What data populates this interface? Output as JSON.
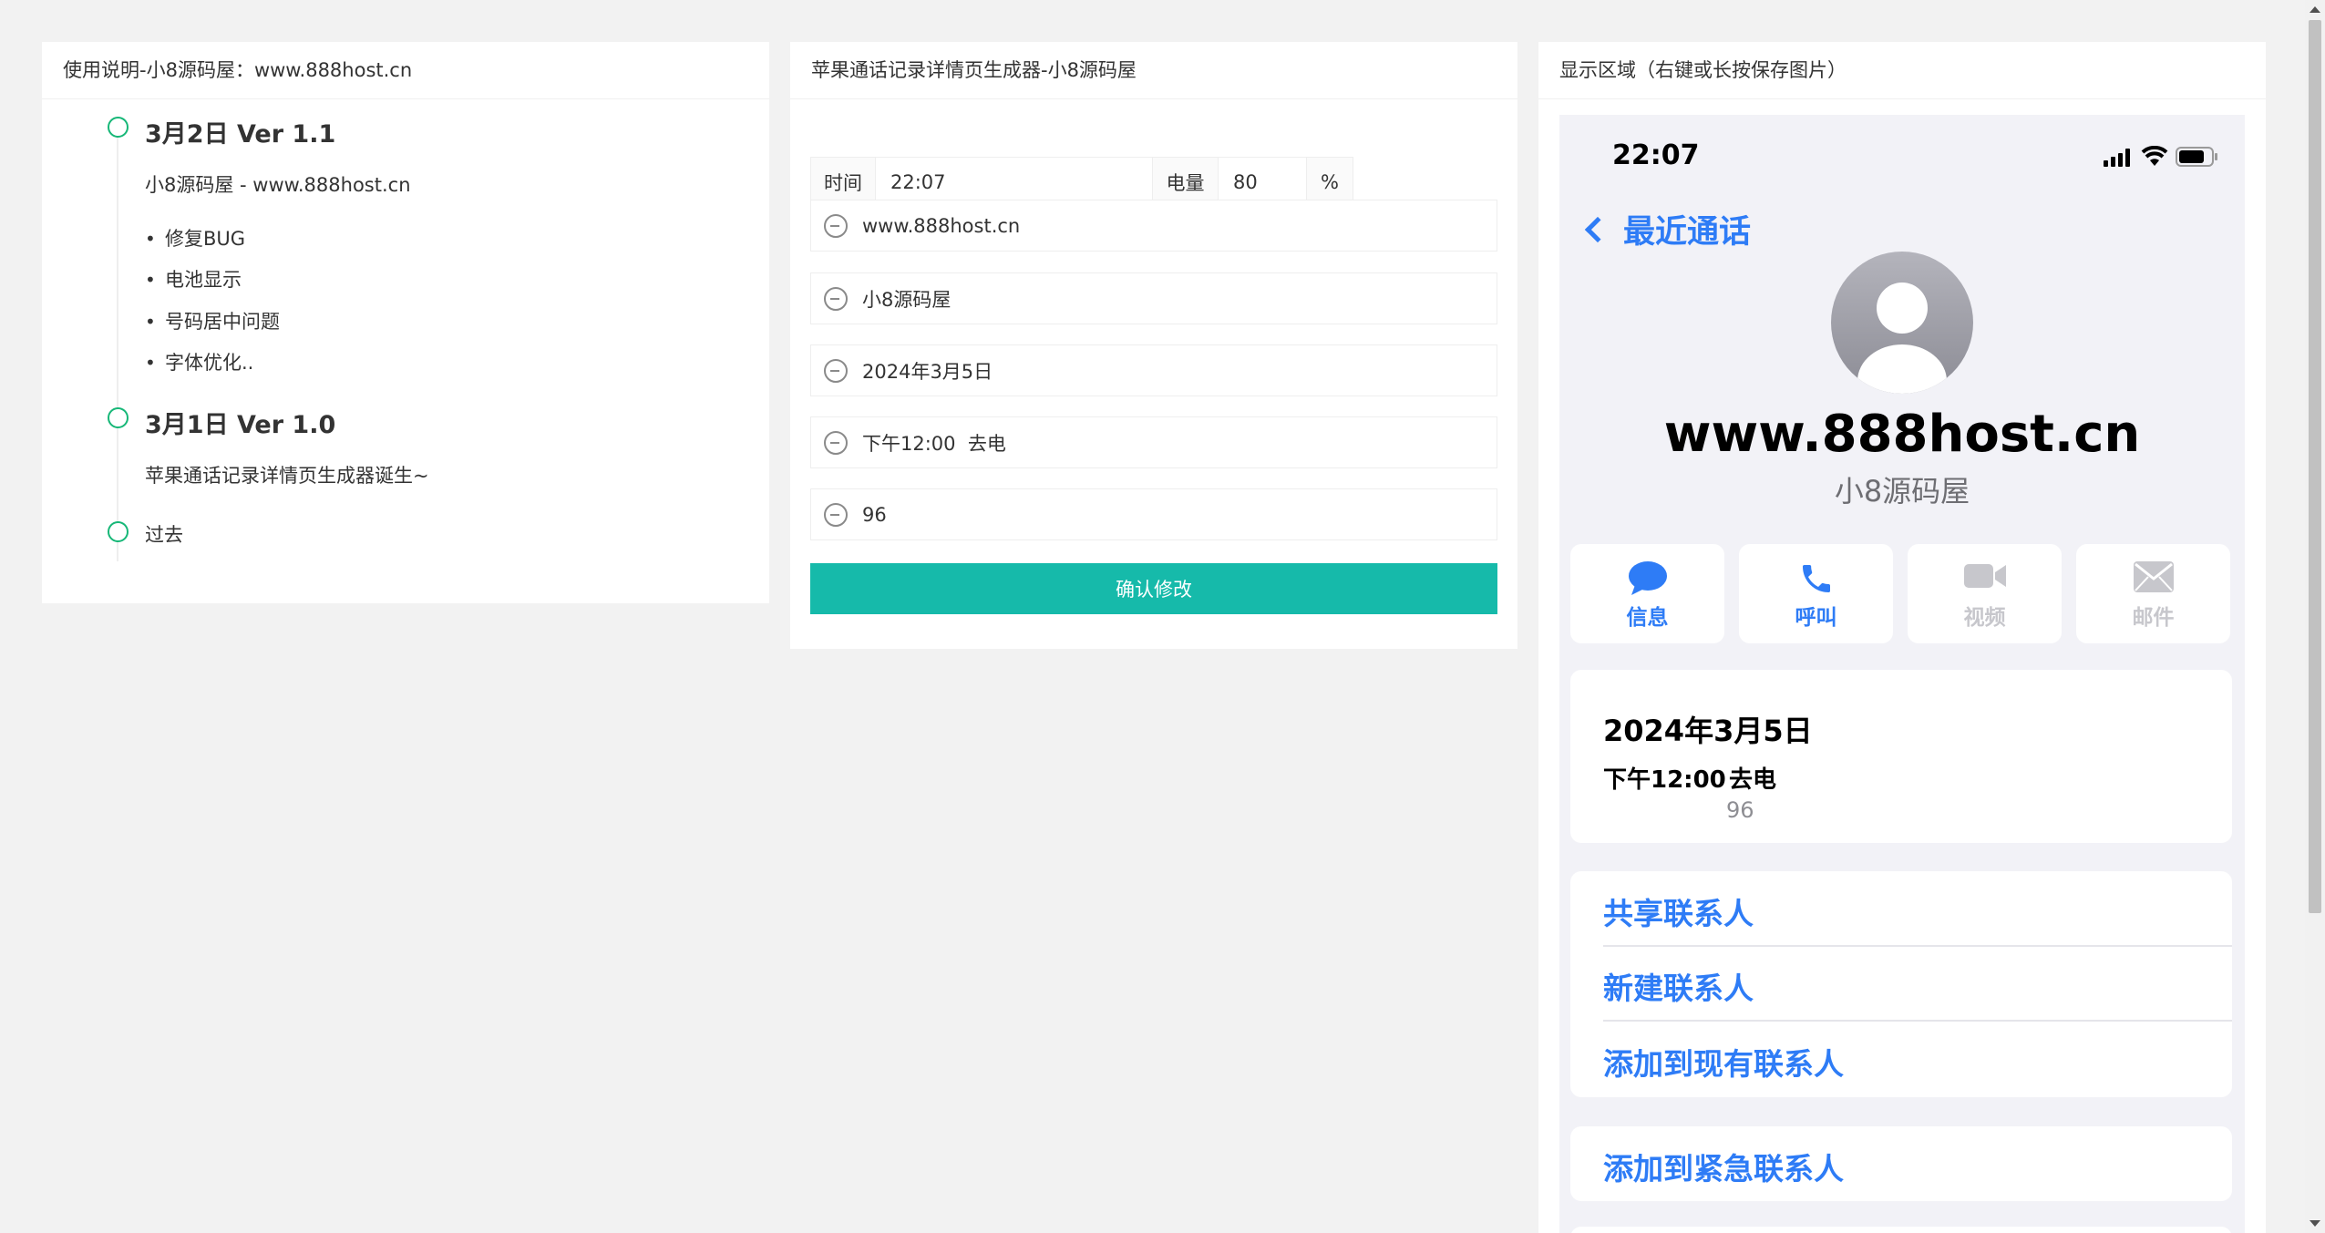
{
  "instructions_panel": {
    "title": "使用说明-小8源码屋：www.888host.cn",
    "timeline": [
      {
        "title": "3月2日 Ver 1.1",
        "text": "小8源码屋 - www.888host.cn",
        "items": [
          "修复BUG",
          "电池显示",
          "号码居中问题",
          "字体优化.."
        ]
      },
      {
        "title": "3月1日 Ver 1.0",
        "text": "苹果通话记录详情页生成器诞生~"
      },
      {
        "text": "过去"
      }
    ]
  },
  "generator_panel": {
    "title": "苹果通话记录详情页生成器-小8源码屋",
    "time_label": "时间",
    "time_value": "22:07",
    "battery_label": "电量",
    "battery_value": "80",
    "battery_unit": "%",
    "fields": [
      "www.888host.cn",
      "小8源码屋",
      "2024年3月5日",
      "下午12:00  去电",
      "96"
    ],
    "confirm_button": "确认修改"
  },
  "display_panel": {
    "title": "显示区域（右键或长按保存图片）",
    "phone": {
      "status_time": "22:07",
      "battery_level": 0.8,
      "back_label": "最近通话",
      "contact_name": "www.888host.cn",
      "contact_sub": "小8源码屋",
      "actions": [
        {
          "label": "信息",
          "icon": "message-icon",
          "enabled": true
        },
        {
          "label": "呼叫",
          "icon": "phone-icon",
          "enabled": true
        },
        {
          "label": "视频",
          "icon": "video-icon",
          "enabled": false
        },
        {
          "label": "邮件",
          "icon": "mail-icon",
          "enabled": false
        }
      ],
      "call_date": "2024年3月5日",
      "call_time": "下午12:00",
      "call_type": "去电",
      "call_duration": "96",
      "contact_options": [
        "共享联系人",
        "新建联系人",
        "添加到现有联系人"
      ],
      "emergency_option": "添加到紧急联系人"
    }
  },
  "colors": {
    "accent": "#16baaa",
    "ios_blue": "#2e7cf6",
    "timeline_green": "#16b777",
    "disabled": "#c7c7cc"
  }
}
